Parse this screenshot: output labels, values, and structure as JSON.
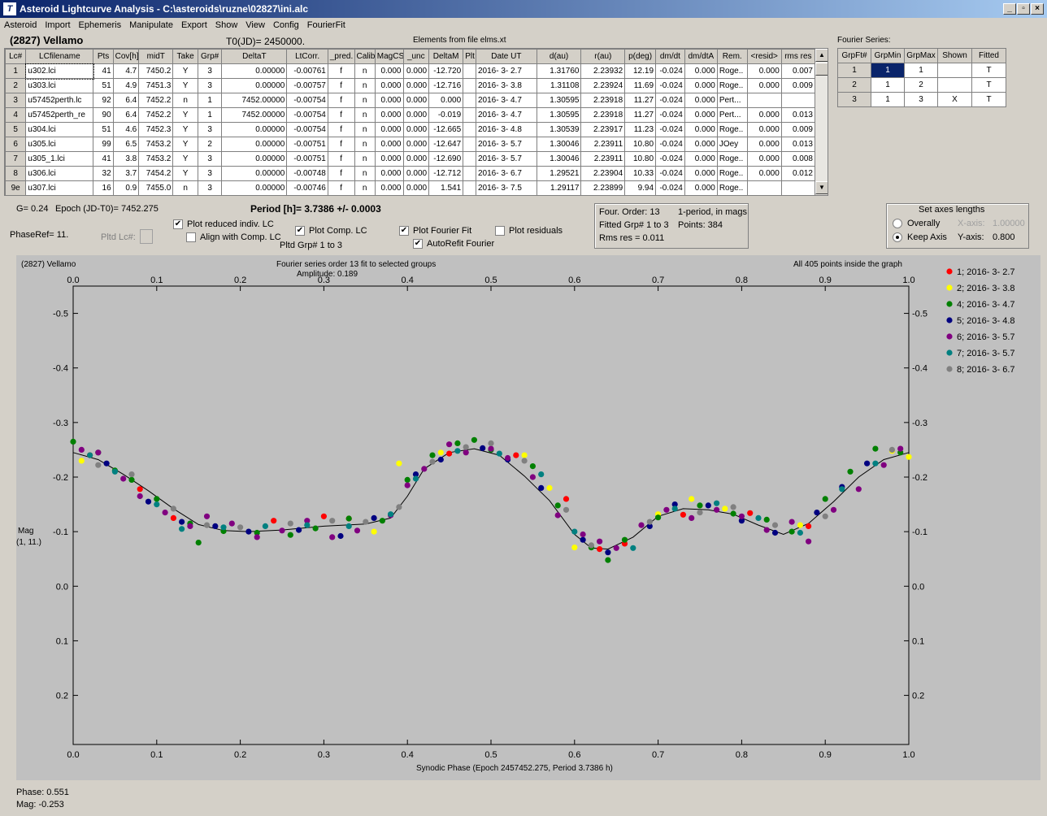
{
  "window": {
    "title": "Asteroid Lightcurve Analysis - C:\\asteroids\\ruzne\\02827\\ini.alc",
    "buttons": [
      "_",
      "▫",
      "×"
    ]
  },
  "menu": [
    "Asteroid",
    "Import",
    "Ephemeris",
    "Manipulate",
    "Export",
    "Show",
    "View",
    "Config",
    "FourierFit"
  ],
  "header": {
    "asteroid": "(2827) Vellamo",
    "t0": "T0(JD)= 2450000.",
    "elements": "Elements from file elms.xt"
  },
  "lc_table": {
    "columns": [
      "Lc#",
      "LCfilename",
      "Pts",
      "Cov[h]",
      "midT",
      "Take",
      "Grp#",
      "DeltaT",
      "LtCorr.",
      "_pred.",
      "Calib",
      "MagCS",
      "_unc",
      "DeltaM",
      "Plt",
      "Date UT",
      "d(au)",
      "r(au)",
      "p(deg)",
      "dm/dt",
      "dm/dtA",
      "Rem.",
      "<resid>",
      "rms res"
    ],
    "rows": [
      [
        "1",
        "u302.lci",
        "41",
        "4.7",
        "7450.2",
        "Y",
        "3",
        "0.00000",
        "-0.00761",
        "f",
        "n",
        "0.000",
        "0.000",
        "-12.720",
        "",
        "2016- 3- 2.7",
        "1.31760",
        "2.23932",
        "12.19",
        "-0.024",
        "0.000",
        "Roge..",
        "0.000",
        "0.007"
      ],
      [
        "2",
        "u303.lci",
        "51",
        "4.9",
        "7451.3",
        "Y",
        "3",
        "0.00000",
        "-0.00757",
        "f",
        "n",
        "0.000",
        "0.000",
        "-12.716",
        "",
        "2016- 3- 3.8",
        "1.31108",
        "2.23924",
        "11.69",
        "-0.024",
        "0.000",
        "Roge..",
        "0.000",
        "0.009"
      ],
      [
        "3",
        "u57452perth.lc",
        "92",
        "6.4",
        "7452.2",
        "n",
        "1",
        "7452.00000",
        "-0.00754",
        "f",
        "n",
        "0.000",
        "0.000",
        "0.000",
        "",
        "2016- 3- 4.7",
        "1.30595",
        "2.23918",
        "11.27",
        "-0.024",
        "0.000",
        "Pert...",
        "",
        ""
      ],
      [
        "4",
        "u57452perth_re",
        "90",
        "6.4",
        "7452.2",
        "Y",
        "1",
        "7452.00000",
        "-0.00754",
        "f",
        "n",
        "0.000",
        "0.000",
        "-0.019",
        "",
        "2016- 3- 4.7",
        "1.30595",
        "2.23918",
        "11.27",
        "-0.024",
        "0.000",
        "Pert...",
        "0.000",
        "0.013"
      ],
      [
        "5",
        "u304.lci",
        "51",
        "4.6",
        "7452.3",
        "Y",
        "3",
        "0.00000",
        "-0.00754",
        "f",
        "n",
        "0.000",
        "0.000",
        "-12.665",
        "",
        "2016- 3- 4.8",
        "1.30539",
        "2.23917",
        "11.23",
        "-0.024",
        "0.000",
        "Roge..",
        "0.000",
        "0.009"
      ],
      [
        "6",
        "u305.lci",
        "99",
        "6.5",
        "7453.2",
        "Y",
        "2",
        "0.00000",
        "-0.00751",
        "f",
        "n",
        "0.000",
        "0.000",
        "-12.647",
        "",
        "2016- 3- 5.7",
        "1.30046",
        "2.23911",
        "10.80",
        "-0.024",
        "0.000",
        "JOey",
        "0.000",
        "0.013"
      ],
      [
        "7",
        "u305_1.lci",
        "41",
        "3.8",
        "7453.2",
        "Y",
        "3",
        "0.00000",
        "-0.00751",
        "f",
        "n",
        "0.000",
        "0.000",
        "-12.690",
        "",
        "2016- 3- 5.7",
        "1.30046",
        "2.23911",
        "10.80",
        "-0.024",
        "0.000",
        "Roge..",
        "0.000",
        "0.008"
      ],
      [
        "8",
        "u306.lci",
        "32",
        "3.7",
        "7454.2",
        "Y",
        "3",
        "0.00000",
        "-0.00748",
        "f",
        "n",
        "0.000",
        "0.000",
        "-12.712",
        "",
        "2016- 3- 6.7",
        "1.29521",
        "2.23904",
        "10.33",
        "-0.024",
        "0.000",
        "Roge..",
        "0.000",
        "0.012"
      ],
      [
        "9e",
        "u307.lci",
        "16",
        "0.9",
        "7455.0",
        "n",
        "3",
        "0.00000",
        "-0.00746",
        "f",
        "n",
        "0.000",
        "0.000",
        "1.541",
        "",
        "2016- 3- 7.5",
        "1.29117",
        "2.23899",
        "9.94",
        "-0.024",
        "0.000",
        "Roge..",
        "",
        ""
      ]
    ]
  },
  "fourier_series": {
    "label": "Fourier Series:",
    "columns": [
      "GrpFt#",
      "GrpMin",
      "GrpMax",
      "Shown",
      "Fitted"
    ],
    "rows": [
      [
        "1",
        "1",
        "1",
        "",
        "T"
      ],
      [
        "2",
        "1",
        "2",
        "",
        "T"
      ],
      [
        "3",
        "1",
        "3",
        "X",
        "T"
      ]
    ]
  },
  "params": {
    "g": "G= 0.24",
    "epoch": "Epoch (JD-T0)= 7452.275",
    "period": "Period [h]= 3.7386 +/- 0.0003",
    "phaseref": "PhaseRef= 11.",
    "pltd_lc": "Pltd Lc#:",
    "plot_reduced": "Plot reduced indiv. LC",
    "align_comp": "Align with Comp. LC",
    "plot_comp": "Plot Comp. LC",
    "pltd_grp": "Pltd Grp#  1  to  3",
    "plot_fourier": "Plot Fourier Fit",
    "autorefit": "AutoRefit Fourier",
    "plot_resid": "Plot residuals"
  },
  "fit_info": {
    "order": "Four. Order: 13",
    "mode": "1-period, in mags",
    "fitted": "Fitted Grp# 1 to 3",
    "points": "Points: 384",
    "rms": "Rms res     = 0.011"
  },
  "axes_box": {
    "title": "Set axes lengths",
    "overally": "Overally",
    "keep": "Keep Axis",
    "xaxis_label": "X-axis:",
    "xaxis_val": "1.00000",
    "yaxis_label": "Y-axis:",
    "yaxis_val": "0.800"
  },
  "plot": {
    "name": "(2827) Vellamo",
    "title": "Fourier series order 13 fit to selected groups",
    "amplitude": "Amplitude: 0.189",
    "inside": "All 405 points inside the graph",
    "ylabel1": "Mag",
    "ylabel2": "(1, 11.)",
    "xlabel": "Synodic Phase (Epoch 2457452.275, Period 3.7386 h)"
  },
  "chart_data": {
    "type": "scatter",
    "xlim": [
      0.0,
      1.0
    ],
    "ylim": [
      -0.55,
      0.29
    ],
    "y_inverted": true,
    "xticks": [
      "0.0",
      "0.1",
      "0.2",
      "0.3",
      "0.4",
      "0.5",
      "0.6",
      "0.7",
      "0.8",
      "0.9",
      "1.0"
    ],
    "yticks": [
      "-0.5",
      "-0.4",
      "-0.3",
      "-0.2",
      "-0.1",
      "0.0",
      "0.1",
      "0.2"
    ],
    "legend": [
      {
        "name": "1; 2016- 3- 2.7",
        "color": "#ff0000"
      },
      {
        "name": "2; 2016- 3- 3.8",
        "color": "#ffff00"
      },
      {
        "name": "4; 2016- 3- 4.7",
        "color": "#008000"
      },
      {
        "name": "5; 2016- 3- 4.8",
        "color": "#000080"
      },
      {
        "name": "6; 2016- 3- 5.7",
        "color": "#800080"
      },
      {
        "name": "7; 2016- 3- 5.7",
        "color": "#008080"
      },
      {
        "name": "8; 2016- 3- 6.7",
        "color": "#808080"
      }
    ],
    "fit_curve": {
      "x": [
        0.0,
        0.03,
        0.06,
        0.09,
        0.12,
        0.15,
        0.18,
        0.21,
        0.25,
        0.3,
        0.35,
        0.38,
        0.4,
        0.42,
        0.45,
        0.48,
        0.51,
        0.54,
        0.57,
        0.6,
        0.62,
        0.64,
        0.67,
        0.7,
        0.73,
        0.76,
        0.79,
        0.82,
        0.85,
        0.88,
        0.91,
        0.94,
        0.97,
        1.0
      ],
      "y": [
        -0.245,
        -0.232,
        -0.205,
        -0.175,
        -0.142,
        -0.113,
        -0.102,
        -0.1,
        -0.103,
        -0.11,
        -0.114,
        -0.125,
        -0.165,
        -0.215,
        -0.245,
        -0.252,
        -0.24,
        -0.202,
        -0.157,
        -0.095,
        -0.07,
        -0.068,
        -0.09,
        -0.128,
        -0.142,
        -0.14,
        -0.132,
        -0.112,
        -0.095,
        -0.115,
        -0.155,
        -0.2,
        -0.232,
        -0.245
      ]
    },
    "series": [
      {
        "name": "1; 2016- 3- 2.7",
        "color": "#ff0000",
        "x": [
          0.02,
          0.08,
          0.12,
          0.24,
          0.3,
          0.33,
          0.45,
          0.53,
          0.59,
          0.63,
          0.66,
          0.73,
          0.81,
          0.88
        ],
        "y": [
          -0.24,
          -0.178,
          -0.125,
          -0.12,
          -0.128,
          -0.124,
          -0.243,
          -0.24,
          -0.16,
          -0.068,
          -0.078,
          -0.131,
          -0.134,
          -0.11
        ]
      },
      {
        "name": "2; 2016- 3- 3.8",
        "color": "#ffff00",
        "x": [
          0.01,
          0.36,
          0.39,
          0.44,
          0.54,
          0.57,
          0.6,
          0.7,
          0.74,
          0.78,
          0.87,
          0.98,
          1.0
        ],
        "y": [
          -0.23,
          -0.1,
          -0.225,
          -0.245,
          -0.24,
          -0.18,
          -0.071,
          -0.132,
          -0.16,
          -0.142,
          -0.112,
          -0.248,
          -0.237
        ]
      },
      {
        "name": "4; 2016- 3- 4.7",
        "color": "#008000",
        "x": [
          0.0,
          0.03,
          0.05,
          0.07,
          0.1,
          0.14,
          0.15,
          0.18,
          0.22,
          0.26,
          0.29,
          0.33,
          0.37,
          0.4,
          0.43,
          0.46,
          0.48,
          0.5,
          0.55,
          0.58,
          0.62,
          0.64,
          0.66,
          0.7,
          0.75,
          0.79,
          0.83,
          0.86,
          0.9,
          0.93,
          0.96,
          0.99
        ],
        "y": [
          -0.265,
          -0.245,
          -0.212,
          -0.195,
          -0.16,
          -0.115,
          -0.08,
          -0.101,
          -0.098,
          -0.094,
          -0.106,
          -0.124,
          -0.12,
          -0.195,
          -0.24,
          -0.262,
          -0.268,
          -0.25,
          -0.22,
          -0.148,
          -0.071,
          -0.048,
          -0.085,
          -0.126,
          -0.148,
          -0.133,
          -0.122,
          -0.1,
          -0.16,
          -0.21,
          -0.252,
          -0.245
        ]
      },
      {
        "name": "5; 2016- 3- 4.8",
        "color": "#000080",
        "x": [
          0.04,
          0.09,
          0.13,
          0.17,
          0.21,
          0.27,
          0.32,
          0.36,
          0.41,
          0.44,
          0.49,
          0.52,
          0.56,
          0.61,
          0.64,
          0.69,
          0.72,
          0.76,
          0.8,
          0.84,
          0.89,
          0.92,
          0.95
        ],
        "y": [
          -0.225,
          -0.155,
          -0.118,
          -0.11,
          -0.1,
          -0.103,
          -0.092,
          -0.125,
          -0.205,
          -0.232,
          -0.253,
          -0.232,
          -0.18,
          -0.085,
          -0.062,
          -0.11,
          -0.15,
          -0.148,
          -0.12,
          -0.098,
          -0.135,
          -0.182,
          -0.225
        ]
      },
      {
        "name": "6; 2016- 3- 5.7",
        "color": "#800080",
        "x": [
          0.01,
          0.03,
          0.06,
          0.08,
          0.11,
          0.14,
          0.16,
          0.19,
          0.22,
          0.25,
          0.28,
          0.31,
          0.34,
          0.38,
          0.4,
          0.42,
          0.45,
          0.47,
          0.5,
          0.52,
          0.55,
          0.58,
          0.61,
          0.63,
          0.65,
          0.68,
          0.71,
          0.74,
          0.77,
          0.8,
          0.83,
          0.86,
          0.88,
          0.91,
          0.94,
          0.97,
          0.99
        ],
        "y": [
          -0.25,
          -0.245,
          -0.197,
          -0.165,
          -0.135,
          -0.11,
          -0.128,
          -0.115,
          -0.09,
          -0.102,
          -0.12,
          -0.09,
          -0.102,
          -0.13,
          -0.185,
          -0.215,
          -0.26,
          -0.245,
          -0.252,
          -0.235,
          -0.2,
          -0.13,
          -0.095,
          -0.082,
          -0.07,
          -0.112,
          -0.14,
          -0.125,
          -0.14,
          -0.128,
          -0.103,
          -0.118,
          -0.082,
          -0.14,
          -0.178,
          -0.222,
          -0.252
        ]
      },
      {
        "name": "7; 2016- 3- 5.7",
        "color": "#008080",
        "x": [
          0.02,
          0.05,
          0.1,
          0.13,
          0.18,
          0.23,
          0.28,
          0.33,
          0.38,
          0.41,
          0.46,
          0.51,
          0.56,
          0.6,
          0.67,
          0.72,
          0.77,
          0.82,
          0.87,
          0.92,
          0.96
        ],
        "y": [
          -0.24,
          -0.21,
          -0.15,
          -0.105,
          -0.108,
          -0.11,
          -0.112,
          -0.11,
          -0.132,
          -0.197,
          -0.248,
          -0.243,
          -0.205,
          -0.1,
          -0.07,
          -0.142,
          -0.152,
          -0.125,
          -0.098,
          -0.178,
          -0.225
        ]
      },
      {
        "name": "8; 2016- 3- 6.7",
        "color": "#808080",
        "x": [
          0.03,
          0.07,
          0.12,
          0.16,
          0.2,
          0.26,
          0.31,
          0.35,
          0.39,
          0.43,
          0.47,
          0.5,
          0.54,
          0.59,
          0.62,
          0.69,
          0.75,
          0.79,
          0.84,
          0.9,
          0.98
        ],
        "y": [
          -0.222,
          -0.205,
          -0.142,
          -0.112,
          -0.108,
          -0.115,
          -0.12,
          -0.118,
          -0.145,
          -0.228,
          -0.255,
          -0.262,
          -0.23,
          -0.14,
          -0.075,
          -0.118,
          -0.135,
          -0.145,
          -0.112,
          -0.128,
          -0.25
        ]
      }
    ]
  },
  "status": {
    "phase": "Phase:  0.551",
    "mag": "Mag:    -0.253"
  }
}
